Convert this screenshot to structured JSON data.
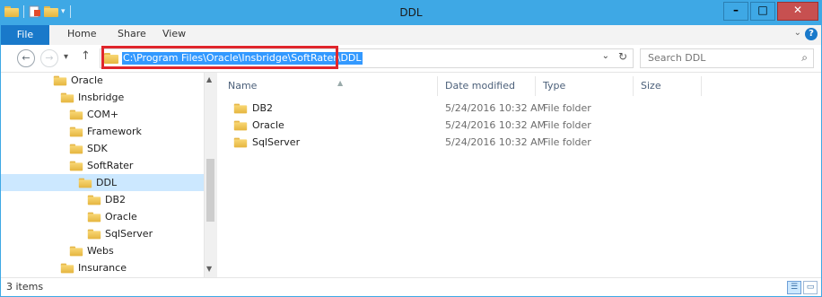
{
  "window": {
    "title": "DDL"
  },
  "ribbon": {
    "tabs": [
      {
        "label": "File"
      },
      {
        "label": "Home"
      },
      {
        "label": "Share"
      },
      {
        "label": "View"
      }
    ]
  },
  "navigation": {
    "back_icon": "arrow-left-icon",
    "forward_icon": "arrow-right-icon",
    "up_icon": "arrow-up-icon",
    "address_path": "C:\\Program Files\\Oracle\\Insbridge\\SoftRater\\DDL",
    "search_placeholder": "Search DDL"
  },
  "tree": [
    {
      "label": "Oracle",
      "level": 0
    },
    {
      "label": "Insbridge",
      "level": 1
    },
    {
      "label": "COM+",
      "level": 2
    },
    {
      "label": "Framework",
      "level": 2
    },
    {
      "label": "SDK",
      "level": 2
    },
    {
      "label": "SoftRater",
      "level": 2
    },
    {
      "label": "DDL",
      "level": 3,
      "selected": true
    },
    {
      "label": "DB2",
      "level": 4
    },
    {
      "label": "Oracle",
      "level": 4
    },
    {
      "label": "SqlServer",
      "level": 4
    },
    {
      "label": "Webs",
      "level": 2
    },
    {
      "label": "Insurance",
      "level": 1
    }
  ],
  "columns": {
    "name": "Name",
    "date_modified": "Date modified",
    "type": "Type",
    "size": "Size"
  },
  "files": [
    {
      "name": "DB2",
      "date_modified": "5/24/2016 10:32 AM",
      "type": "File folder",
      "size": ""
    },
    {
      "name": "Oracle",
      "date_modified": "5/24/2016 10:32 AM",
      "type": "File folder",
      "size": ""
    },
    {
      "name": "SqlServer",
      "date_modified": "5/24/2016 10:32 AM",
      "type": "File folder",
      "size": ""
    }
  ],
  "status": {
    "item_count": "3 items"
  },
  "colors": {
    "titlebar": "#3ea8e5",
    "file_tab": "#1979ca",
    "selection": "#cce8ff",
    "address_highlight": "#3399ff",
    "callout_border": "#e0262c"
  }
}
